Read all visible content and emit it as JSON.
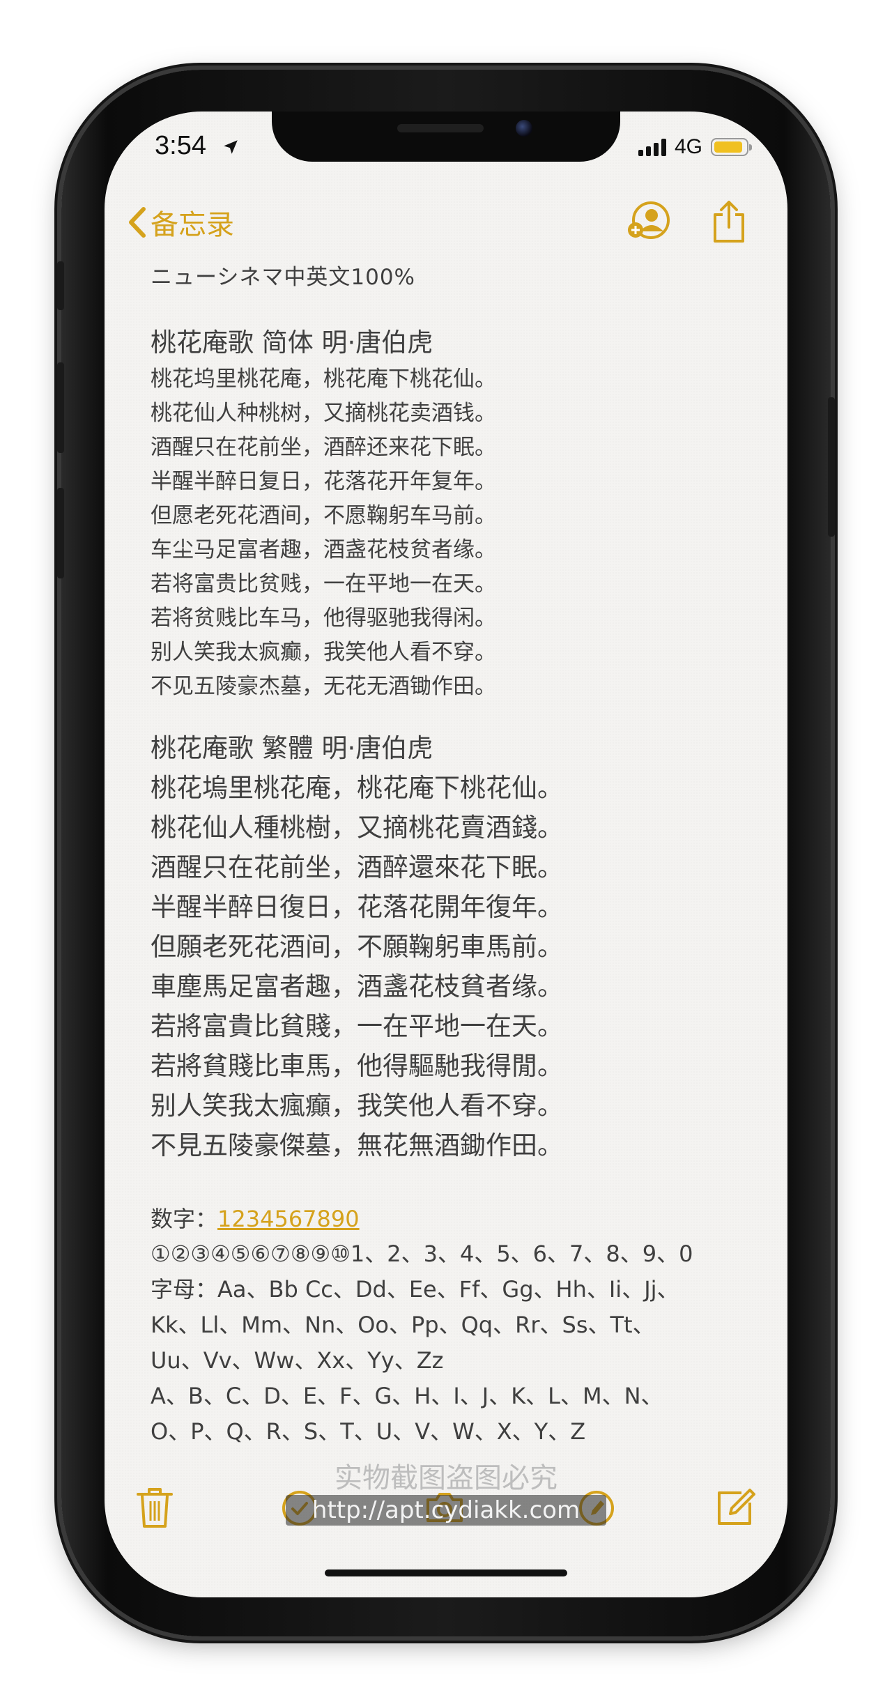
{
  "status_bar": {
    "time": "3:54",
    "network": "4G",
    "battery_color": "#f0c020"
  },
  "nav": {
    "back_label": "备忘录",
    "accent_color": "#d5a21c",
    "icons": [
      "chevron-left-icon",
      "add-people-icon",
      "share-icon"
    ]
  },
  "note": {
    "title": "ニューシネマ中英文100%",
    "simplified": {
      "heading": "桃花庵歌 简体  明·唐伯虎",
      "lines": [
        "桃花坞里桃花庵，桃花庵下桃花仙。",
        "桃花仙人种桃树，又摘桃花卖酒钱。",
        "酒醒只在花前坐，酒醉还来花下眠。",
        "半醒半醉日复日，花落花开年复年。",
        "但愿老死花酒间，不愿鞠躬车马前。",
        "车尘马足富者趣，酒盏花枝贫者缘。",
        "若将富贵比贫贱，一在平地一在天。",
        "若将贫贱比车马，他得驱驰我得闲。",
        "别人笑我太疯癫，我笑他人看不穿。",
        "不见五陵豪杰墓，无花无酒锄作田。"
      ]
    },
    "traditional": {
      "heading": "桃花庵歌 繁體    明·唐伯虎",
      "lines": [
        "桃花塢里桃花庵，桃花庵下桃花仙。",
        "桃花仙人種桃樹，又摘桃花賣酒錢。",
        "酒醒只在花前坐，酒醉還來花下眠。",
        "半醒半醉日復日，花落花開年復年。",
        "但願老死花酒间，不願鞠躬車馬前。",
        "車塵馬足富者趣，酒盞花枝貧者缘。",
        "若將富貴比貧賤，一在平地一在天。",
        "若將貧賤比車馬，他得驅馳我得閒。",
        "别人笑我太瘋癲，我笑他人看不穿。",
        "不見五陵豪傑墓，無花無酒鋤作田。"
      ]
    },
    "numbers_label": "数字：",
    "numbers_link": "1234567890",
    "circled_line": "①②③④⑤⑥⑦⑧⑨⑩1、2、3、4、5、6、7、8、9、0",
    "letter_lines": [
      "字母：Aa、Bb Cc、Dd、Ee、Ff、Gg、Hh、Ii、Jj、",
      "Kk、Ll、Mm、Nn、Oo、Pp、Qq、Rr、Ss、Tt、",
      "Uu、Vv、Ww、Xx、Yy、Zz",
      "A、B、C、D、E、F、G、H、I、J、K、L、M、N、",
      "O、P、Q、R、S、T、U、V、W、X、Y、Z"
    ]
  },
  "watermark": {
    "text": "实物截图盗图必究",
    "url": "http://apt.cydiakk.com"
  },
  "toolbar": {
    "icons": [
      "trash-icon",
      "checklist-icon",
      "camera-icon",
      "pen-icon",
      "compose-icon"
    ]
  }
}
